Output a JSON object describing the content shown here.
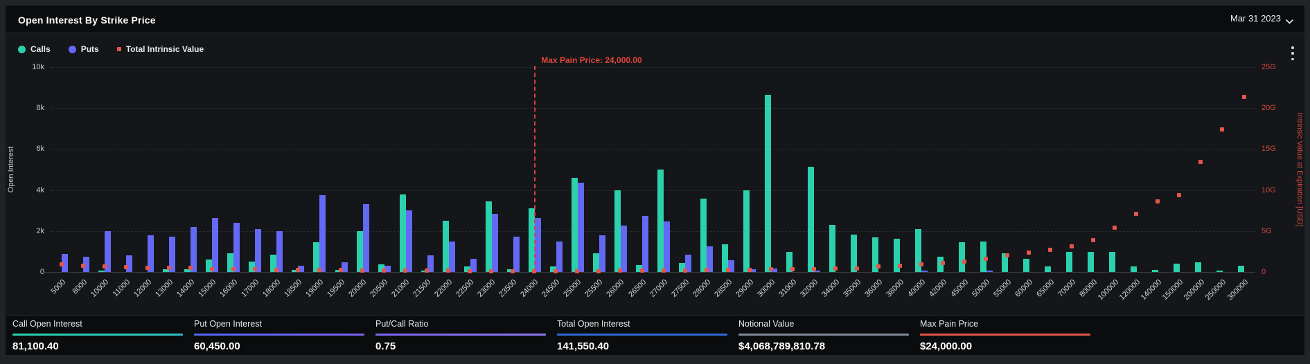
{
  "header": {
    "title": "Open Interest By Strike Price",
    "date_label": "Mar 31 2023"
  },
  "icons": {
    "date_dropdown": "chevron-down",
    "more_options": "kebab-vertical"
  },
  "legend": {
    "items": [
      {
        "label": "Calls",
        "color": "#2bd1ac",
        "shape": "circle"
      },
      {
        "label": "Puts",
        "color": "#6469f4",
        "shape": "circle"
      },
      {
        "label": "Total Intrinsic Value",
        "color": "#e4564d",
        "shape": "square"
      }
    ]
  },
  "chart_data": {
    "type": "bar",
    "title": "Open Interest By Strike Price",
    "categories": [
      "5000",
      "8000",
      "10000",
      "11000",
      "12000",
      "13000",
      "14000",
      "15000",
      "16000",
      "17000",
      "18000",
      "18500",
      "19000",
      "19500",
      "20000",
      "20500",
      "21000",
      "21500",
      "22000",
      "22500",
      "23000",
      "23500",
      "24000",
      "24500",
      "25000",
      "25500",
      "26000",
      "26500",
      "27000",
      "27500",
      "28000",
      "28500",
      "29000",
      "30000",
      "31000",
      "32000",
      "34000",
      "35000",
      "36000",
      "38000",
      "40000",
      "42000",
      "45000",
      "50000",
      "55000",
      "60000",
      "65000",
      "70000",
      "80000",
      "100000",
      "120000",
      "140000",
      "150000",
      "200000",
      "250000",
      "300000"
    ],
    "series": [
      {
        "name": "Calls",
        "type": "bar",
        "axis": "left",
        "color": "#2bd1ac",
        "values": [
          0,
          0,
          30,
          0,
          0,
          120,
          150,
          620,
          900,
          500,
          840,
          90,
          1450,
          90,
          2000,
          370,
          3800,
          70,
          2500,
          280,
          3450,
          120,
          3100,
          260,
          4600,
          930,
          4000,
          340,
          5000,
          430,
          3570,
          1360,
          4000,
          8650,
          970,
          5150,
          2300,
          1830,
          1700,
          1630,
          2100,
          760,
          1470,
          1500,
          910,
          650,
          260,
          990,
          990,
          970,
          260,
          90,
          400,
          460,
          40,
          300
        ]
      },
      {
        "name": "Puts",
        "type": "bar",
        "axis": "left",
        "color": "#6469f4",
        "values": [
          880,
          750,
          2000,
          820,
          1780,
          1730,
          2200,
          2650,
          2400,
          2100,
          2000,
          300,
          3750,
          470,
          3300,
          310,
          3000,
          820,
          1500,
          650,
          2840,
          1740,
          2620,
          1500,
          4350,
          1800,
          2250,
          2730,
          2480,
          840,
          1240,
          570,
          130,
          160,
          0,
          30,
          0,
          0,
          0,
          0,
          70,
          0,
          0,
          45,
          0,
          0,
          0,
          0,
          0,
          0,
          0,
          0,
          0,
          0,
          0,
          0
        ]
      },
      {
        "name": "Total Intrinsic Value",
        "type": "scatter",
        "axis": "right",
        "color": "#e4564d",
        "values_G": [
          0.95,
          0.8,
          0.65,
          0.62,
          0.52,
          0.55,
          0.48,
          0.35,
          0.34,
          0.3,
          0.28,
          0.27,
          0.22,
          0.22,
          0.21,
          0.2,
          0.19,
          0.15,
          0.14,
          0.13,
          0.12,
          0.11,
          0.1,
          0.11,
          0.12,
          0.13,
          0.15,
          0.17,
          0.19,
          0.21,
          0.23,
          0.25,
          0.27,
          0.3,
          0.33,
          0.37,
          0.42,
          0.46,
          0.65,
          0.8,
          0.93,
          1.07,
          1.3,
          1.63,
          2.0,
          2.34,
          2.73,
          3.12,
          3.88,
          5.43,
          7.1,
          8.6,
          9.4,
          13.4,
          17.4,
          21.4
        ]
      }
    ],
    "left_axis": {
      "label": "Open Interest",
      "range": [
        0,
        10000
      ],
      "ticks": [
        "0",
        "2k",
        "4k",
        "6k",
        "8k",
        "10k"
      ],
      "grid": "dotted"
    },
    "right_axis": {
      "label": "Intrinsic Value at Expiration [USD]",
      "range_G": [
        0,
        25
      ],
      "ticks": [
        "0",
        "5G",
        "10G",
        "15G",
        "20G",
        "25G"
      ]
    },
    "max_pain": {
      "strike": "24000",
      "label": "Max Pain Price: 24,000.00",
      "color": "#d6453c"
    },
    "legend_position": "top-left"
  },
  "stats": {
    "items": [
      {
        "label": "Call Open Interest",
        "value": "81,100.40",
        "accent": [
          "#2ad2ac",
          "#2fc0c4"
        ]
      },
      {
        "label": "Put Open Interest",
        "value": "60,450.00",
        "accent": [
          "#4e68f0",
          "#7c61ef"
        ]
      },
      {
        "label": "Put/Call Ratio",
        "value": "0.75",
        "accent": [
          "#7a64ee",
          "#8c79f1"
        ]
      },
      {
        "label": "Total Open Interest",
        "value": "141,550.40",
        "accent": [
          "#2e6cd6",
          "#2e6cd6"
        ]
      },
      {
        "label": "Notional Value",
        "value": "$4,068,789,810.78",
        "accent": [
          "#7e8a99",
          "#7e8a99"
        ]
      },
      {
        "label": "Max Pain Price",
        "value": "$24,000.00",
        "accent": [
          "#e15648",
          "#e15648"
        ]
      }
    ]
  }
}
